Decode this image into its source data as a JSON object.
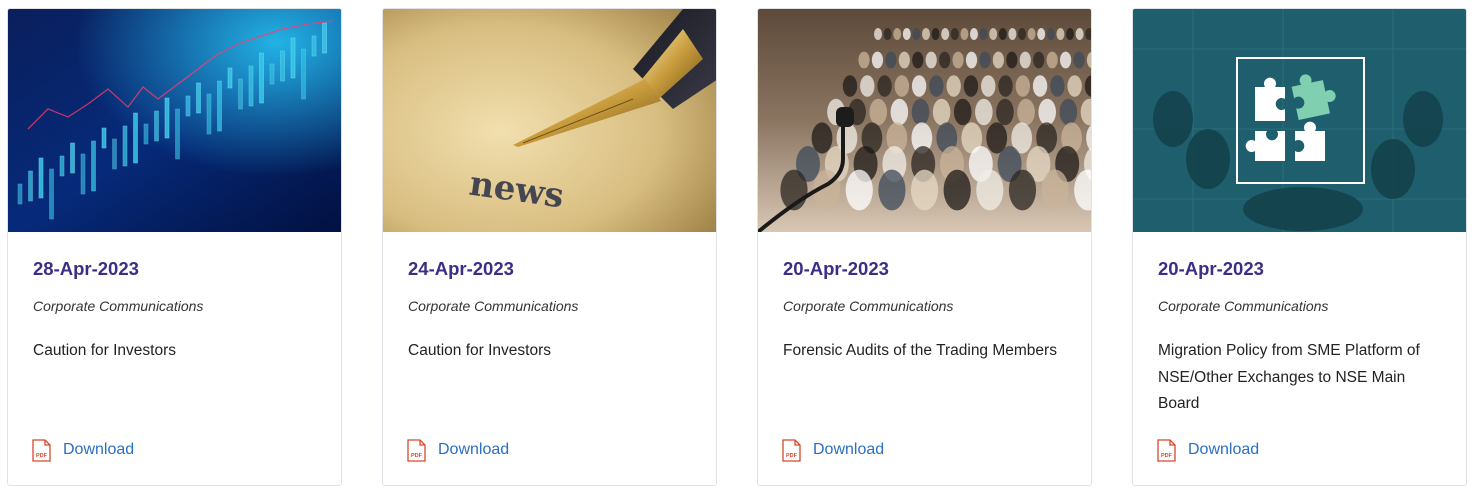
{
  "cards": [
    {
      "date": "28-Apr-2023",
      "category": "Corporate Communications",
      "title": "Caution for Investors",
      "download_label": "Download",
      "image": "stock-chart-image"
    },
    {
      "date": "24-Apr-2023",
      "category": "Corporate Communications",
      "title": "Caution for Investors",
      "download_label": "Download",
      "image": "fountain-pen-news-image",
      "image_text": "news"
    },
    {
      "date": "20-Apr-2023",
      "category": "Corporate Communications",
      "title": "Forensic Audits of the Trading Members",
      "download_label": "Download",
      "image": "conference-audience-image"
    },
    {
      "date": "20-Apr-2023",
      "category": "Corporate Communications",
      "title": "Migration Policy from SME Platform of NSE/Other Exchanges to NSE Main Board",
      "download_label": "Download",
      "image": "puzzle-pieces-image"
    }
  ],
  "pdf_icon_text": "PDF",
  "colors": {
    "date": "#3b2f85",
    "link": "#2a6fc4",
    "pdf": "#d9472b"
  }
}
